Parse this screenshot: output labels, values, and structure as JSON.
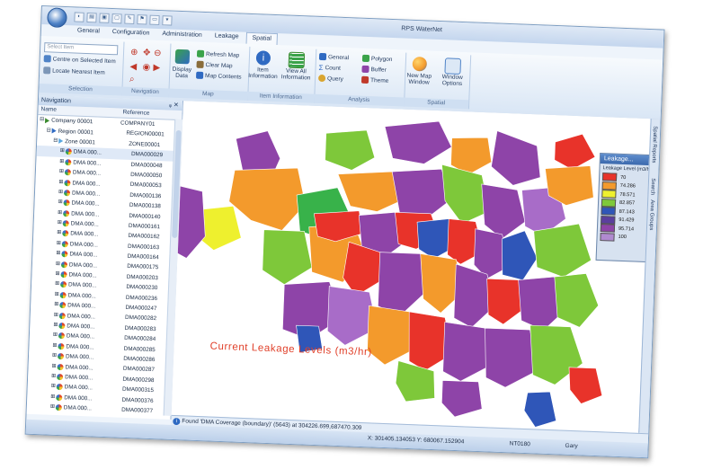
{
  "app": {
    "title": "RPS WaterNet"
  },
  "quick_access": [
    "◐",
    "▤",
    "▣",
    "▢",
    "✎",
    "⚑",
    "▭",
    "▾"
  ],
  "tabs": [
    "General",
    "Configuration",
    "Administration",
    "Leakage",
    "Spatial"
  ],
  "ribbon": {
    "selection": {
      "combo_placeholder": "Select Item",
      "centre_btn": "Centre on Selected Item",
      "locate_btn": "Locate Nearest Item",
      "label": "Selection"
    },
    "navigation": {
      "label": "Navigation"
    },
    "map": {
      "display_data": "Display Data",
      "refresh": "Refresh Map",
      "clear": "Clear Map",
      "contents": "Map Contents",
      "label": "Map"
    },
    "item_info": {
      "item_information": "Item Information",
      "view_all": "View All Information",
      "label": "Item Information"
    },
    "analysis": {
      "general": "General",
      "count": "Count",
      "query": "Query",
      "polygon": "Polygon",
      "buffer": "Buffer",
      "theme": "Theme",
      "label": "Analysis"
    },
    "spatial": {
      "new_map": "New Map Window",
      "window_options": "Window Options",
      "label": "Spatial"
    }
  },
  "navigation": {
    "title": "Navigation",
    "pin": "ᵩ ✕",
    "col_name": "Name",
    "col_ref": "Reference",
    "rows": [
      {
        "name": "Company 00001",
        "ref": "COMPANY01"
      },
      {
        "name": "Region 00001",
        "ref": "REGION00001"
      },
      {
        "name": "Zone 00001",
        "ref": "ZONE00001"
      },
      {
        "name": "DMA 000...",
        "ref": "DMA000029"
      },
      {
        "name": "DMA 000...",
        "ref": "DMA000048"
      },
      {
        "name": "DMA 000...",
        "ref": "DMA000050"
      },
      {
        "name": "DMA 000...",
        "ref": "DMA000053"
      },
      {
        "name": "DMA 000...",
        "ref": "DMA000136"
      },
      {
        "name": "DMA 000...",
        "ref": "DMA000138"
      },
      {
        "name": "DMA 000...",
        "ref": "DMA000140"
      },
      {
        "name": "DMA 000...",
        "ref": "DMA000161"
      },
      {
        "name": "DMA 000...",
        "ref": "DMA000162"
      },
      {
        "name": "DMA 000...",
        "ref": "DMA000163"
      },
      {
        "name": "DMA 000...",
        "ref": "DMA000164"
      },
      {
        "name": "DMA 000...",
        "ref": "DMA000175"
      },
      {
        "name": "DMA 000...",
        "ref": "DMA000203"
      },
      {
        "name": "DMA 000...",
        "ref": "DMA000230"
      },
      {
        "name": "DMA 000...",
        "ref": "DMA000236"
      },
      {
        "name": "DMA 000...",
        "ref": "DMA000247"
      },
      {
        "name": "DMA 000...",
        "ref": "DMA000282"
      },
      {
        "name": "DMA 000...",
        "ref": "DMA000283"
      },
      {
        "name": "DMA 000...",
        "ref": "DMA000284"
      },
      {
        "name": "DMA 000...",
        "ref": "DMA000285"
      },
      {
        "name": "DMA 000...",
        "ref": "DMA000286"
      },
      {
        "name": "DMA 000...",
        "ref": "DMA000287"
      },
      {
        "name": "DMA 000...",
        "ref": "DMA000298"
      },
      {
        "name": "DMA 000...",
        "ref": "DMA000315"
      },
      {
        "name": "DMA 000...",
        "ref": "DMA000376"
      },
      {
        "name": "DMA 000...",
        "ref": "DMA000377"
      }
    ]
  },
  "map": {
    "title": "Current Leakage Levels (m3/hr)",
    "colors": {
      "red": "#e8332a",
      "orange": "#f39a2c",
      "yellow": "#eef02e",
      "green": "#7ec83a",
      "darkgreen": "#38b24a",
      "blue": "#2f56b8",
      "purple": "#8e44a8",
      "lav": "#a86cc8"
    }
  },
  "legend": {
    "title": "Leakage...",
    "subtitle": "Leakage Level (m3/hr)",
    "items": [
      {
        "label": "70",
        "color": "#e8332a"
      },
      {
        "label": "74.286",
        "color": "#f39a2c"
      },
      {
        "label": "78.571",
        "color": "#eef02e"
      },
      {
        "label": "82.857",
        "color": "#7ec83a"
      },
      {
        "label": "87.143",
        "color": "#2f56b8"
      },
      {
        "label": "91.429",
        "color": "#5b3e9e"
      },
      {
        "label": "95.714",
        "color": "#8e44a8"
      },
      {
        "label": "100",
        "color": "#b08ad0"
      }
    ]
  },
  "side_tabs": [
    "Spatial Reports",
    "Search",
    "Area Groups"
  ],
  "status": {
    "found": "Found 'DMA Coverage (boundary)' (5643) at 304226.699,687470.309",
    "coords": "X: 301405.134053  Y: 680067.152904",
    "coord_sys": "NT0180",
    "user": "Gary"
  }
}
